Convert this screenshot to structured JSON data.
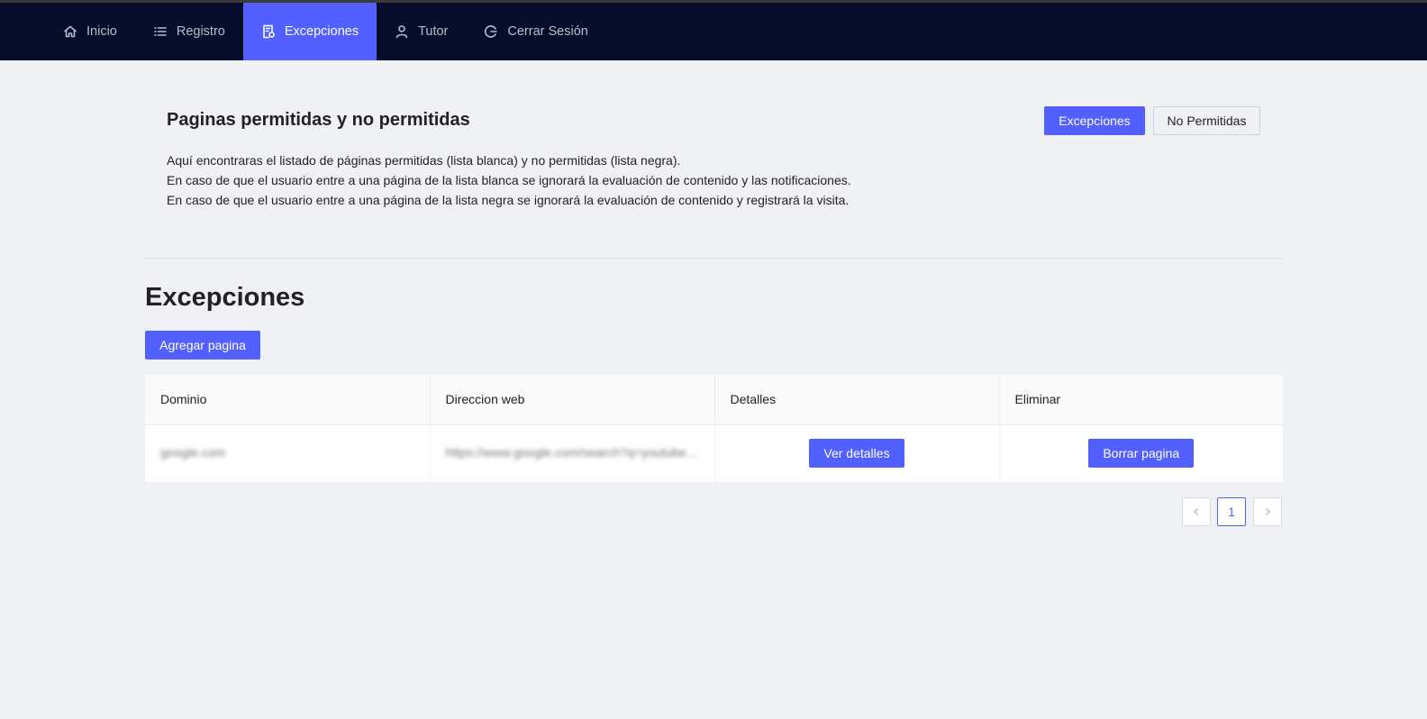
{
  "nav": {
    "items": [
      {
        "label": "Inicio",
        "icon": "home-icon"
      },
      {
        "label": "Registro",
        "icon": "list-icon"
      },
      {
        "label": "Excepciones",
        "icon": "document-icon",
        "active": true
      },
      {
        "label": "Tutor",
        "icon": "user-icon"
      },
      {
        "label": "Cerrar Sesión",
        "icon": "logout-icon"
      }
    ]
  },
  "intro": {
    "title": "Paginas permitidas y no permitidas",
    "lines": [
      "Aquí encontraras el listado de páginas permitidas (lista blanca) y no permitidas (lista negra).",
      "En caso de que el usuario entre a una página de la lista blanca se ignorará la evaluación de contenido y las notificaciones.",
      "En caso de que el usuario entre a una página de la lista negra se ignorará la evaluación de contenido y registrará la visita."
    ],
    "toggle_exceptions": "Excepciones",
    "toggle_not_allowed": "No Permitidas"
  },
  "section": {
    "title": "Excepciones",
    "add_button": "Agregar pagina"
  },
  "table": {
    "headers": [
      "Dominio",
      "Direccion web",
      "Detalles",
      "Eliminar"
    ],
    "rows": [
      {
        "domain": "google.com",
        "url": "https://www.google.com/search?q=youtube...",
        "details_button": "Ver detalles",
        "delete_button": "Borrar pagina"
      }
    ]
  },
  "pagination": {
    "current_page": "1"
  },
  "colors": {
    "accent": "#5260ff",
    "navbar": "#050d2a",
    "background": "#f0f1f5"
  }
}
